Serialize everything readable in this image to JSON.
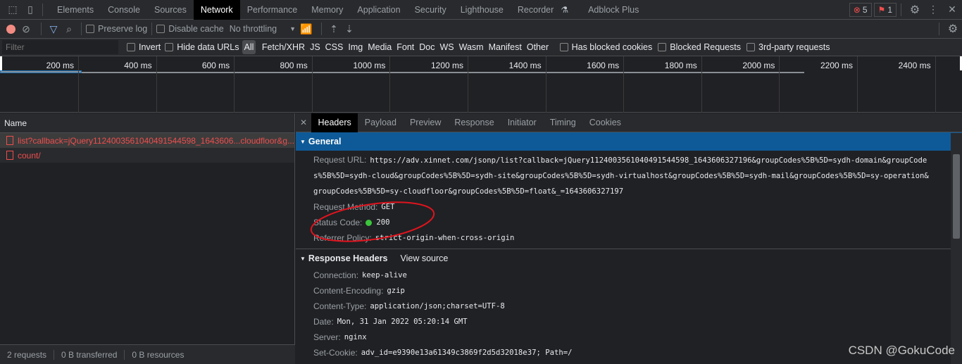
{
  "tabbar": {
    "tabs": [
      "Elements",
      "Console",
      "Sources",
      "Network",
      "Performance",
      "Memory",
      "Application",
      "Security",
      "Lighthouse",
      "Recorder",
      "Adblock Plus"
    ],
    "active": "Network",
    "errors": "5",
    "issues": "1"
  },
  "toolbar": {
    "preserve_log": "Preserve log",
    "disable_cache": "Disable cache",
    "throttling": "No throttling"
  },
  "filterbar": {
    "placeholder": "Filter",
    "invert": "Invert",
    "hide_data_urls": "Hide data URLs",
    "types": [
      "All",
      "Fetch/XHR",
      "JS",
      "CSS",
      "Img",
      "Media",
      "Font",
      "Doc",
      "WS",
      "Wasm",
      "Manifest",
      "Other"
    ],
    "active_type": "All",
    "has_blocked_cookies": "Has blocked cookies",
    "blocked_requests": "Blocked Requests",
    "third_party": "3rd-party requests"
  },
  "timeline": {
    "ticks": [
      "200 ms",
      "400 ms",
      "600 ms",
      "800 ms",
      "1000 ms",
      "1200 ms",
      "1400 ms",
      "1600 ms",
      "1800 ms",
      "2000 ms",
      "2200 ms",
      "2400 ms"
    ]
  },
  "requests": {
    "header": "Name",
    "items": [
      "list?callback=jQuery1124003561040491544598_1643606...cloudfloor&g...",
      "count/"
    ]
  },
  "status": {
    "requests": "2 requests",
    "transferred": "0 B transferred",
    "resources": "0 B resources"
  },
  "details": {
    "tabs": [
      "Headers",
      "Payload",
      "Preview",
      "Response",
      "Initiator",
      "Timing",
      "Cookies"
    ],
    "active": "Headers",
    "general": {
      "title": "General",
      "request_url_label": "Request URL:",
      "request_url_lines": [
        "https://adv.xinnet.com/jsonp/list?callback=jQuery1124003561040491544598_1643606327196&groupCodes%5B%5D=sydh-domain&groupCode",
        "s%5B%5D=sydh-cloud&groupCodes%5B%5D=sydh-site&groupCodes%5B%5D=sydh-virtualhost&groupCodes%5B%5D=sydh-mail&groupCodes%5B%5D=sy-operation&",
        "groupCodes%5B%5D=sy-cloudfloor&groupCodes%5B%5D=float&_=1643606327197"
      ],
      "rows": [
        {
          "k": "Request Method:",
          "v": "GET"
        },
        {
          "k": "Status Code:",
          "v": "200"
        },
        {
          "k": "Referrer Policy:",
          "v": "strict-origin-when-cross-origin"
        }
      ]
    },
    "response_headers": {
      "title": "Response Headers",
      "view_source": "View source",
      "rows": [
        {
          "k": "Connection:",
          "v": "keep-alive"
        },
        {
          "k": "Content-Encoding:",
          "v": "gzip"
        },
        {
          "k": "Content-Type:",
          "v": "application/json;charset=UTF-8"
        },
        {
          "k": "Date:",
          "v": "Mon, 31 Jan 2022 05:20:14 GMT"
        },
        {
          "k": "Server:",
          "v": "nginx"
        },
        {
          "k": "Set-Cookie:",
          "v": "adv_id=e9390e13a61349c3869f2d5d32018e37; Path=/"
        }
      ]
    }
  },
  "watermark": "CSDN @GokuCode",
  "colors": {
    "accent": "#0e5a98",
    "error": "#ee4e4e",
    "status_ok": "#3cc43c",
    "annotation": "#e0141e"
  }
}
